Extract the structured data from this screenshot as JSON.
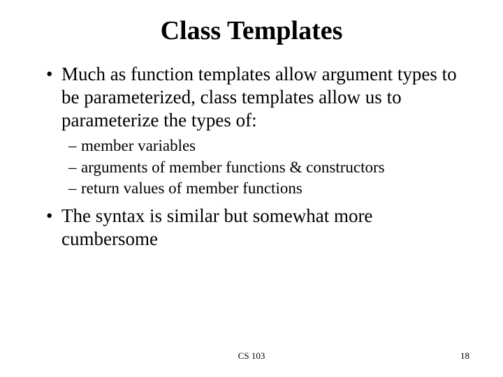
{
  "title": "Class Templates",
  "bullets": [
    {
      "text": "Much as function templates allow argument types to be parameterized, class templates allow us to parameterize the types of:",
      "subs": [
        "member variables",
        "arguments of member functions & constructors",
        "return values of member functions"
      ]
    },
    {
      "text": "The syntax is similar but somewhat more cumbersome",
      "subs": []
    }
  ],
  "footer": "CS 103",
  "pageNumber": "18"
}
